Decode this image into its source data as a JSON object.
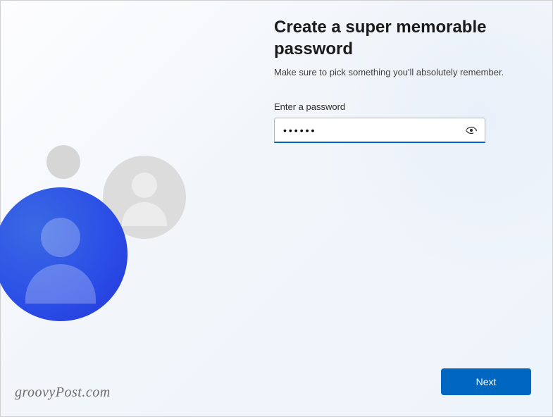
{
  "header": {
    "title": "Create a super memorable password",
    "subtitle": "Make sure to pick something you'll absolutely remember."
  },
  "form": {
    "password_label": "Enter a password",
    "password_value": "••••••",
    "password_type": "password",
    "reveal_icon_name": "eye-reveal-icon"
  },
  "actions": {
    "next_label": "Next"
  },
  "watermark": {
    "text": "groovyPost.com"
  },
  "colors": {
    "accent": "#0067c0",
    "primary_avatar": "#2a4de6"
  }
}
